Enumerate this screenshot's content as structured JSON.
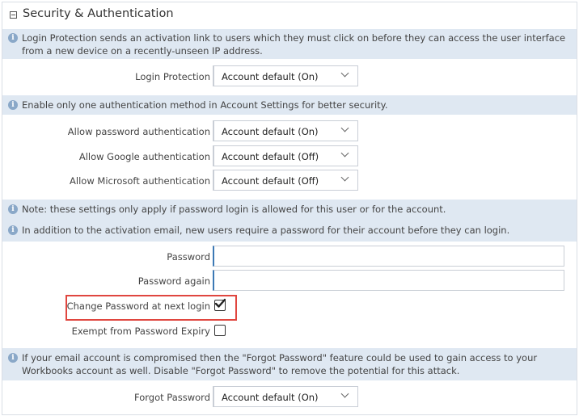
{
  "section": {
    "title": "Security & Authentication"
  },
  "info": {
    "login_protection": "Login Protection sends an activation link to users which they must click on before they can access the user interface from a new device on a recently-unseen IP address.",
    "auth_method": "Enable only one authentication method in Account Settings for better security.",
    "password_note": "Note: these settings only apply if password login is allowed for this user or for the account.",
    "activation_note": "In addition to the activation email, new users require a password for their account before they can login.",
    "forgot_note": "If your email account is compromised then the \"Forgot Password\" feature could be used to gain access to your Workbooks account as well. Disable \"Forgot Password\" to remove the potential for this attack."
  },
  "fields": {
    "login_protection": {
      "label": "Login Protection",
      "value": "Account default (On)"
    },
    "allow_password": {
      "label": "Allow password authentication",
      "value": "Account default (On)"
    },
    "allow_google": {
      "label": "Allow Google authentication",
      "value": "Account default (Off)"
    },
    "allow_microsoft": {
      "label": "Allow Microsoft authentication",
      "value": "Account default (Off)"
    },
    "password": {
      "label": "Password",
      "value": ""
    },
    "password_again": {
      "label": "Password again",
      "value": ""
    },
    "change_password": {
      "label": "Change Password at next login",
      "checked": true
    },
    "exempt_expiry": {
      "label": "Exempt from Password Expiry",
      "checked": false
    },
    "forgot_password": {
      "label": "Forgot Password",
      "value": "Account default (On)"
    }
  },
  "colors": {
    "info_bg": "#dfe8f2",
    "highlight": "#e0463f",
    "input_focus": "#3c79b5"
  }
}
